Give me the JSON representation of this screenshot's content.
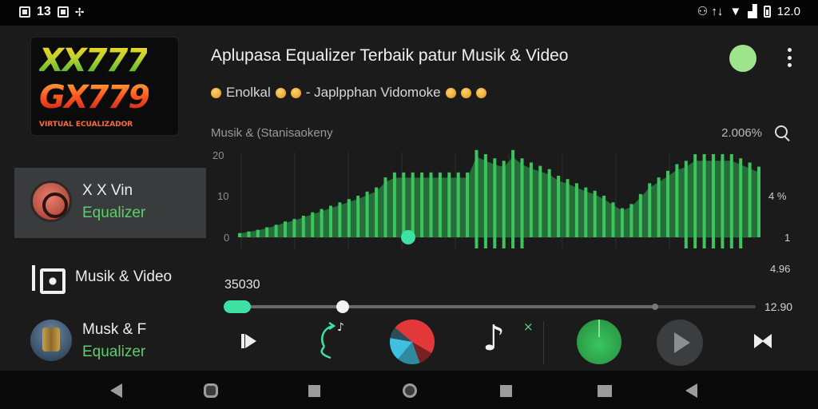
{
  "status_bar": {
    "left_time": "13",
    "right_time": "12.0",
    "right_glyphs": "⚇ ↑↓"
  },
  "logo": {
    "line1": "XX777",
    "line2": "GX779",
    "line3": "VIRTUAL ECUALIZADOR"
  },
  "header": {
    "title": "Aplupasa Equalizer Terbaik patur Musik & Video",
    "subtitle_part1": "Enolkal",
    "subtitle_part2": "- Japlpphan Vidomoke"
  },
  "sidebar": {
    "items": [
      {
        "name": "X X Vin",
        "sub": "Equalizer",
        "active": true
      },
      {
        "name": "Musik & Video",
        "sub": ""
      },
      {
        "name": "Musk & F",
        "sub": "Equalizer"
      }
    ]
  },
  "equalizer": {
    "label": "Musik &  (Stanisaokeny",
    "value": "2.006%",
    "y_ticks": [
      "20",
      "10",
      "0"
    ],
    "right_ticks": [
      "4 %",
      "1",
      "4.96"
    ],
    "accent": "#3cc45e",
    "fill_color": "#2b8a45",
    "band_levels": [
      0.05,
      0.07,
      0.09,
      0.12,
      0.15,
      0.19,
      0.22,
      0.26,
      0.3,
      0.34,
      0.38,
      0.42,
      0.46,
      0.5,
      0.55,
      0.6,
      0.72,
      0.78,
      0.78,
      0.78,
      0.78,
      0.78,
      0.78,
      0.78,
      0.78,
      0.78,
      1.05,
      1.0,
      0.95,
      0.92,
      1.05,
      0.95,
      0.9,
      0.86,
      0.82,
      0.74,
      0.7,
      0.65,
      0.6,
      0.56,
      0.5,
      0.42,
      0.35,
      0.4,
      0.52,
      0.65,
      0.72,
      0.8,
      0.88,
      0.92,
      1.0,
      1.0,
      1.0,
      1.0,
      1.0,
      0.95,
      0.9,
      0.85
    ]
  },
  "playback": {
    "elapsed": "35030",
    "total": "12.90",
    "progress": 0.81
  },
  "controls": {
    "note_symbol": "♪",
    "note_badge": "×",
    "repeat_symbol": "♪"
  }
}
